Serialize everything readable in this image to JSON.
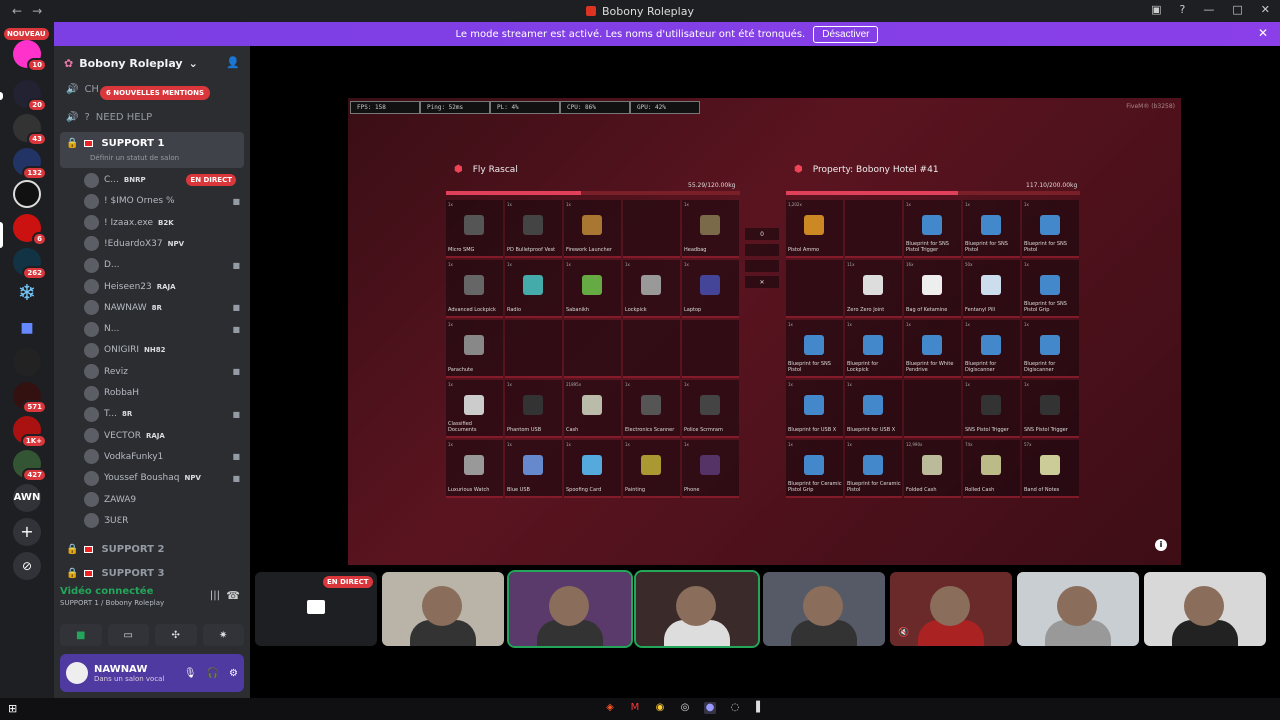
{
  "window": {
    "title": "Bobony Roleplay"
  },
  "banner": {
    "text": "Le mode streamer est activé. Les noms d'utilisateur ont été tronqués.",
    "button": "Désactiver"
  },
  "servers": {
    "nouveau": "NOUVEAU",
    "badges": [
      "10",
      "20",
      "43",
      "132",
      "6",
      "262",
      "571",
      "1K+",
      "427"
    ],
    "awn": "AWN"
  },
  "sidebar": {
    "server_name": "Bobony Roleplay",
    "channel_ch": "CH",
    "mentions": "6 NOUVELLES MENTIONS",
    "need_help": "NEED HELP",
    "support1": "SUPPORT 1",
    "support1_status": "Définir un statut de salon",
    "support2": "SUPPORT 2",
    "support3": "SUPPORT 3",
    "live": "EN DIRECT",
    "users": [
      {
        "name": "C...",
        "tag": "BNRP"
      },
      {
        "name": "! $IMO Ornes %",
        "tag": ""
      },
      {
        "name": "! Izaax.exe",
        "tag": "B2K"
      },
      {
        "name": "!EduardoX37",
        "tag": "NPV"
      },
      {
        "name": "D...",
        "tag": ""
      },
      {
        "name": "Heiseen23",
        "tag": "RAJA"
      },
      {
        "name": "NAWNAW",
        "tag": "8R"
      },
      {
        "name": "N...",
        "tag": ""
      },
      {
        "name": "ONIGIRI",
        "tag": "NH82"
      },
      {
        "name": "Reviz",
        "tag": ""
      },
      {
        "name": "RobbaH",
        "tag": ""
      },
      {
        "name": "T...",
        "tag": "8R"
      },
      {
        "name": "VECTOR",
        "tag": "RAJA"
      },
      {
        "name": "VodkaFunky1",
        "tag": ""
      },
      {
        "name": "Youssef Boushaq",
        "tag": "NPV"
      },
      {
        "name": "ZAWA9",
        "tag": ""
      },
      {
        "name": "ƷUƐR",
        "tag": ""
      }
    ]
  },
  "voice": {
    "title": "Vidéo connectée",
    "sub": "SUPPORT 1 / Bobony Roleplay"
  },
  "userbar": {
    "name": "NAWNAW",
    "status": "Dans un salon vocal"
  },
  "game": {
    "hud": [
      "FPS: 158",
      "Ping: 52ms",
      "PL: 4%",
      "CPU: 86%",
      "GPU: 42%"
    ],
    "watermark": "FiveM® (b3258)",
    "left": {
      "title": "Fly Rascal",
      "weight": "55.29/120.00kg",
      "fill": 0.46
    },
    "right": {
      "title": "Property: Bobony Hotel #41",
      "weight": "117.10/200.00kg",
      "fill": 0.585
    },
    "mid": [
      "0",
      "",
      "",
      "✕"
    ],
    "left_items": [
      {
        "q": "1x",
        "n": "Micro SMG",
        "c": "#555"
      },
      {
        "q": "1x",
        "n": "PD Bulletproof Vest",
        "c": "#444"
      },
      {
        "q": "1x",
        "n": "Firework Launcher",
        "c": "#a73"
      },
      {
        "q": "",
        "n": "",
        "c": ""
      },
      {
        "q": "1x",
        "n": "Headbag",
        "c": "#7a6a4a"
      },
      {
        "q": "1x",
        "n": "Advanced Lockpick",
        "c": "#666"
      },
      {
        "q": "1x",
        "n": "Radio",
        "c": "#4aa"
      },
      {
        "q": "1x",
        "n": "Sabanikh",
        "c": "#6a4"
      },
      {
        "q": "1x",
        "n": "Lockpick",
        "c": "#999"
      },
      {
        "q": "1x",
        "n": "Laptop",
        "c": "#449"
      },
      {
        "q": "1x",
        "n": "Parachute",
        "c": "#888"
      },
      {
        "q": "",
        "n": "",
        "c": ""
      },
      {
        "q": "",
        "n": "",
        "c": ""
      },
      {
        "q": "",
        "n": "",
        "c": ""
      },
      {
        "q": "",
        "n": "",
        "c": ""
      },
      {
        "q": "1x",
        "n": "Classified Documents",
        "c": "#ccc"
      },
      {
        "q": "1x",
        "n": "Phantom USB",
        "c": "#333"
      },
      {
        "q": "21895x",
        "n": "Cash",
        "c": "#bba"
      },
      {
        "q": "1x",
        "n": "Electronics Scanner",
        "c": "#555"
      },
      {
        "q": "1x",
        "n": "Police Scrmram",
        "c": "#444"
      },
      {
        "q": "1x",
        "n": "Luxurious Watch",
        "c": "#999"
      },
      {
        "q": "1x",
        "n": "Blue USB",
        "c": "#68c"
      },
      {
        "q": "1x",
        "n": "Spoofing Card",
        "c": "#5ad"
      },
      {
        "q": "1x",
        "n": "Painting",
        "c": "#a93"
      },
      {
        "q": "1x",
        "n": "Phone",
        "c": "#536"
      }
    ],
    "right_items": [
      {
        "q": "1,202x",
        "n": "Pistol Ammo",
        "c": "#c82"
      },
      {
        "q": "",
        "n": "",
        "c": ""
      },
      {
        "q": "1x",
        "n": "Blueprint for SNS Pistol Trigger",
        "c": "#48c"
      },
      {
        "q": "1x",
        "n": "Blueprint for SNS Pistol",
        "c": "#48c"
      },
      {
        "q": "1x",
        "n": "Blueprint for SNS Pistol",
        "c": "#48c"
      },
      {
        "q": "",
        "n": "",
        "c": ""
      },
      {
        "q": "11x",
        "n": "Zero Zero Joint",
        "c": "#ddd"
      },
      {
        "q": "16x",
        "n": "Bag of Ketamine",
        "c": "#eee"
      },
      {
        "q": "50x",
        "n": "Fentanyl Pill",
        "c": "#cde"
      },
      {
        "q": "1x",
        "n": "Blueprint for SNS Pistol Grip",
        "c": "#48c"
      },
      {
        "q": "1x",
        "n": "Blueprint for SNS Pistol",
        "c": "#48c"
      },
      {
        "q": "1x",
        "n": "Blueprint for Lockpick",
        "c": "#48c"
      },
      {
        "q": "1x",
        "n": "Blueprint for White Pendrive",
        "c": "#48c"
      },
      {
        "q": "1x",
        "n": "Blueprint for Digiscanner",
        "c": "#48c"
      },
      {
        "q": "1x",
        "n": "Blueprint for Digiscanner",
        "c": "#48c"
      },
      {
        "q": "1x",
        "n": "Blueprint for USB X",
        "c": "#48c"
      },
      {
        "q": "1x",
        "n": "Blueprint for USB X",
        "c": "#48c"
      },
      {
        "q": "",
        "n": "",
        "c": ""
      },
      {
        "q": "1x",
        "n": "SNS Pistol Trigger",
        "c": "#333"
      },
      {
        "q": "1x",
        "n": "SNS Pistol Trigger",
        "c": "#333"
      },
      {
        "q": "1x",
        "n": "Blueprint for Ceramic Pistol Grip",
        "c": "#48c"
      },
      {
        "q": "1x",
        "n": "Blueprint for Ceramic Pistol",
        "c": "#48c"
      },
      {
        "q": "12,990x",
        "n": "Folded Cash",
        "c": "#bb9"
      },
      {
        "q": "74x",
        "n": "Rolled Cash",
        "c": "#bb8"
      },
      {
        "q": "57x",
        "n": "Band of Notes",
        "c": "#cc9"
      }
    ]
  },
  "tiles": {
    "live": "EN DIRECT"
  },
  "colors": {
    "brand": "#5865f2",
    "danger": "#da373c",
    "online": "#23a55a"
  }
}
